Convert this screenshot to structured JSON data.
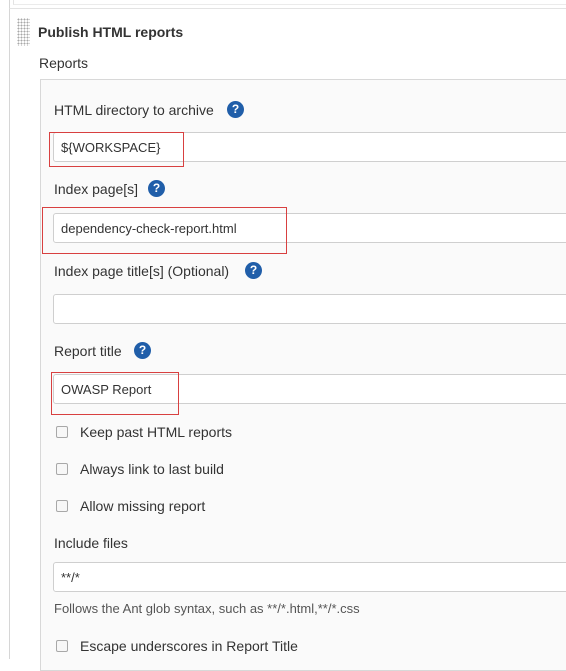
{
  "section": {
    "title": "Publish HTML reports",
    "reports_label": "Reports"
  },
  "fields": {
    "html_directory": {
      "label": "HTML directory to archive",
      "value": "${WORKSPACE}"
    },
    "index_pages": {
      "label": "Index page[s]",
      "value": "dependency-check-report.html"
    },
    "index_titles": {
      "label": "Index page title[s] (Optional)",
      "value": ""
    },
    "report_title": {
      "label": "Report title",
      "value": "OWASP Report"
    },
    "include_files": {
      "label": "Include files",
      "value": "**/*",
      "hint": "Follows the Ant glob syntax, such as **/*.html,**/*.css"
    }
  },
  "checkboxes": {
    "keep_past": {
      "label": "Keep past HTML reports",
      "checked": false
    },
    "always_link": {
      "label": "Always link to last build",
      "checked": false
    },
    "allow_missing": {
      "label": "Allow missing report",
      "checked": false
    },
    "escape_underscores": {
      "label": "Escape underscores in Report Title",
      "checked": false
    }
  },
  "help_icon_glyph": "?",
  "colors": {
    "help_icon": "#205ea9",
    "highlight_border": "#d84040"
  }
}
